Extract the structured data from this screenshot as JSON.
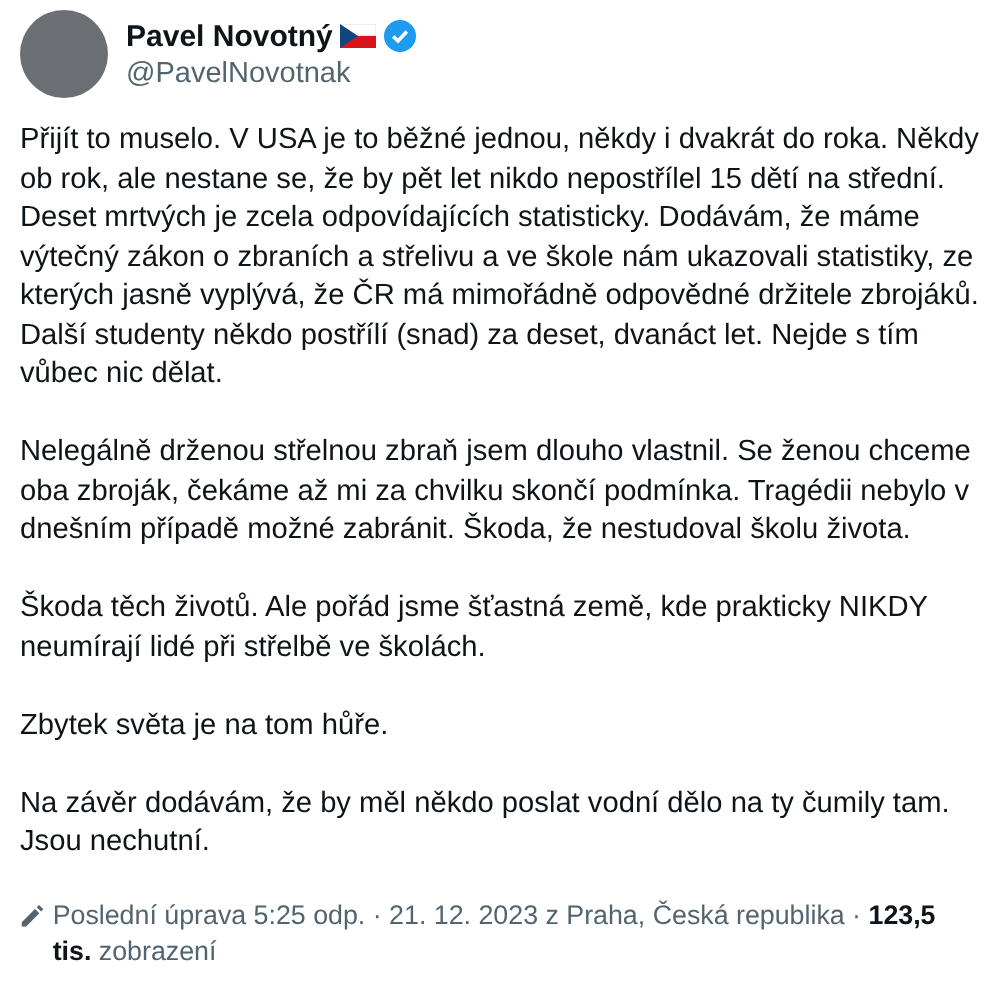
{
  "author": {
    "name": "Pavel Novotný",
    "handle": "@PavelNovotnak",
    "verified": true
  },
  "paragraphs": [
    "Přijít to muselo. V USA je to běžné jednou, někdy i dvakrát do roka. Někdy ob rok, ale nestane se, že by pět let nikdo nepostřílel 15 dětí na střední. Deset mrtvých je zcela odpovídajících statisticky. Dodávám, že máme výtečný zákon o zbraních a střelivu a ve škole nám ukazovali statistiky, ze kterých jasně vyplývá, že ČR má mimořádně odpovědné držitele zbrojáků. Další studenty někdo postřílí (snad) za deset, dvanáct let. Nejde s tím vůbec nic dělat.",
    "Nelegálně drženou střelnou zbraň jsem dlouho vlastnil. Se ženou chceme oba zbroják, čekáme až mi za chvilku skončí podmínka. Tragédii nebylo v dnešním případě možné zabránit. Škoda, že nestudoval školu života.",
    "Škoda těch životů. Ale pořád jsme šťastná země, kde prakticky NIKDY neumírají lidé při střelbě ve školách.",
    "Zbytek světa je na tom hůře.",
    "Na závěr dodávám, že by měl někdo poslat vodní dělo na ty čumily tam. Jsou nechutní."
  ],
  "meta": "Poslední úprava 5:25 odp. · 21. 12. 2023 z Praha, Česká republika · **123,5 tis.** zobrazení"
}
